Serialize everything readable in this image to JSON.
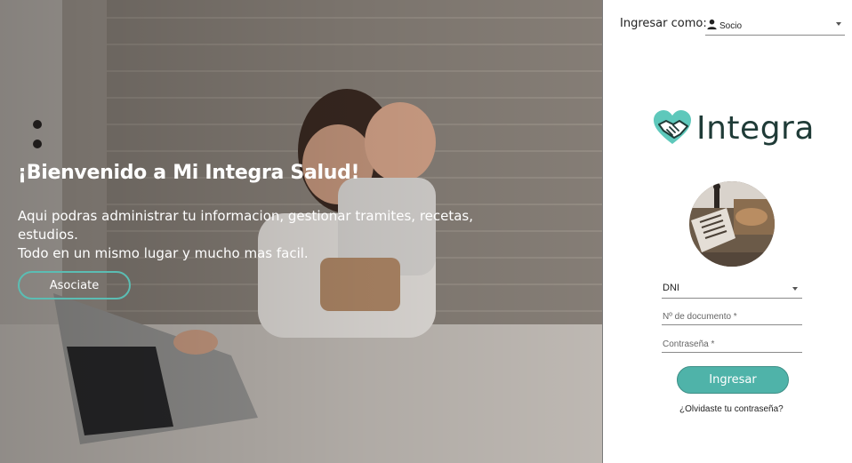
{
  "hero": {
    "title": "¡Bienvenido a Mi Integra Salud!",
    "line1": "Aqui podras administrar tu informacion, gestionar tramites, recetas, estudios.",
    "line2": "Todo en un mismo lugar y mucho mas facil.",
    "cta_label": "Asociate",
    "photo_icon": "mother-child-laptop-photo"
  },
  "panel": {
    "login_as_label": "Ingresar como:",
    "role": {
      "selected": "Socio",
      "icon": "person-icon"
    },
    "logo": {
      "text": "Integra",
      "icon": "heart-handshake-icon"
    },
    "avatar_icon": "desk-avatar-photo",
    "form": {
      "doc_type": "DNI",
      "doc_number_placeholder": "Nº de documento *",
      "password_placeholder": "Contraseña *",
      "submit_label": "Ingresar",
      "forgot_label": "¿Olvidaste tu contraseña?"
    }
  },
  "colors": {
    "accent": "#4fb3a9",
    "accent_border": "#5bbdb3",
    "logo_text": "#1f3b37"
  }
}
